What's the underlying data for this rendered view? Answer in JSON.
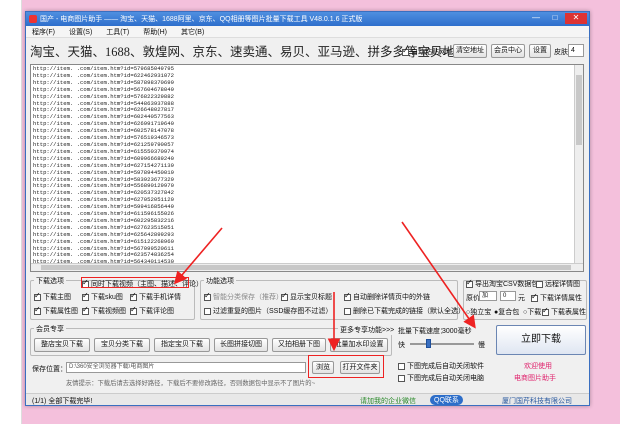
{
  "window": {
    "title": "国产 - 电商图片助手 —— 淘宝、天猫、1688阿里、京东、QQ相册等图片批量下载工具 V48.0.1.6 正式版",
    "min": "—",
    "max": "□",
    "close": "✕"
  },
  "menu": [
    "程序(F)",
    "设置(S)",
    "工具(T)",
    "帮助(H)",
    "其它(B)"
  ],
  "urlbar": {
    "heading": "淘宝、天猫、1688、敦煌网、京东、速卖通、易贝、亚马逊、拼多多等宝贝地址：",
    "auto_paste": "自动粘贴网址",
    "clear": "清空地址",
    "member": "会员中心",
    "settings": "设置",
    "skin_label": "皮肤",
    "skin_value": "4"
  },
  "url_lines": [
    "http://item.        .com/item.htm?id=579685049795",
    "http://item.        .com/item.htm?id=622462931072",
    "http://item.        .com/item.htm?id=587898370699",
    "http://item.        .com/item.htm?id=567604678049",
    "http://item.        .com/item.htm?id=576822329882",
    "http://item.        .com/item.htm?id=544863937888",
    "http://item.        .com/item.htm?id=626648027817",
    "http://item.        .com/item.htm?id=602440577563",
    "http://item.        .com/item.htm?id=626991719640",
    "http://item.        .com/item.htm?id=602578147078",
    "http://item.        .com/item.htm?id=576519346573",
    "http://item.        .com/item.htm?id=621259790057",
    "http://item.        .com/item.htm?id=615550370974",
    "http://item.        .com/item.htm?id=609966689240",
    "http://item.        .com/item.htm?id=627154271139",
    "http://item.        .com/item.htm?id=597894450019",
    "http://item.        .com/item.htm?id=583923677329",
    "http://item.        .com/item.htm?id=556890129970",
    "http://item.        .com/item.htm?id=620537327842",
    "http://item.        .com/item.htm?id=627052051120",
    "http://item.        .com/item.htm?id=599416856449",
    "http://item.        .com/item.htm?id=611596155026",
    "http://item.        .com/item.htm?id=602295832216",
    "http://item.        .com/item.htm?id=627623515051",
    "http://item.        .com/item.htm?id=625642899293",
    "http://item.        .com/item.htm?id=615122268960",
    "http://item.        .com/item.htm?id=567099520611",
    "http://item.        .com/item.htm?id=623574836254",
    "http://item.        .com/item.htm?id=564340114530",
    "http://item.        .com/item.htm?id=592227876549",
    "http://item.        .com/item.htm?id=620570890044"
  ],
  "download_options": {
    "title": "下载选项",
    "items": [
      {
        "label": "同时下载视频（主图、描述、评论）",
        "checked": true
      },
      {
        "label": "下载主图",
        "checked": true
      },
      {
        "label": "下载sku图",
        "checked": true
      },
      {
        "label": "下载手机详情",
        "checked": true
      },
      {
        "label": "下载属性图",
        "checked": true
      },
      {
        "label": "下载视频图",
        "checked": true
      },
      {
        "label": "下载评论图",
        "checked": true
      }
    ]
  },
  "function_options": {
    "title": "功能选项",
    "items": [
      {
        "label": "智能分类保存（推荐）",
        "checked": true
      },
      {
        "label": "显示宝贝标题",
        "checked": true
      },
      {
        "label": "自动删除详情页中的外链",
        "checked": true
      },
      {
        "label": "过滤重复的图片（SSD缓存图不过滤）",
        "checked": false
      },
      {
        "label": "删除已下载完成的链接（默认全选）",
        "checked": false
      }
    ]
  },
  "right_options": {
    "export_csv": "导出淘宝CSV数据包",
    "export_csv_checked": true,
    "keep_detail": "远程详情图",
    "keep_detail_checked": false,
    "price_label": "原价",
    "price_op": "加",
    "price_value": "0",
    "price_unit": "元",
    "download_attr": "下载详情属性",
    "download_attr_checked": true,
    "radio1": "独立宝",
    "radio2": "复合包",
    "radio3": "下载",
    "sku_attr": "下载表属性",
    "sku_attr_checked": true
  },
  "member": {
    "title": "会员专享",
    "buttons": [
      "整店宝贝下载",
      "宝贝分类下载",
      "指定宝贝下载",
      "长图拼接切图",
      "又拍相册下图",
      "批量加水印设置"
    ],
    "more": "更多专享功能>>>"
  },
  "speed": {
    "label": "批量下载速度：",
    "value": "3000毫秒",
    "fast": "快",
    "slow": "慢"
  },
  "save": {
    "label": "保存位置：",
    "path": "D:\\360安全浏览器下载\\电商图片",
    "browse": "浏览",
    "open_folder": "打开文件夹",
    "hint": "友情提示：下载后请去选择好路径，下载后不要修改路径，否则数据包中显示不了图片的~",
    "after_close": "下图完成后自动关闭软件",
    "after_shutdown": "下图完成后自动关闭电脑"
  },
  "start_button": "立即下载",
  "promo": {
    "line1": "欢迎使用",
    "line2": "电商图片助手"
  },
  "status": {
    "left": "(1/1) 全部下载完毕!",
    "middle": "请加我的企业微信",
    "right_tag": "QQ联系",
    "copyright": "厦门国芹科技有限公司"
  }
}
